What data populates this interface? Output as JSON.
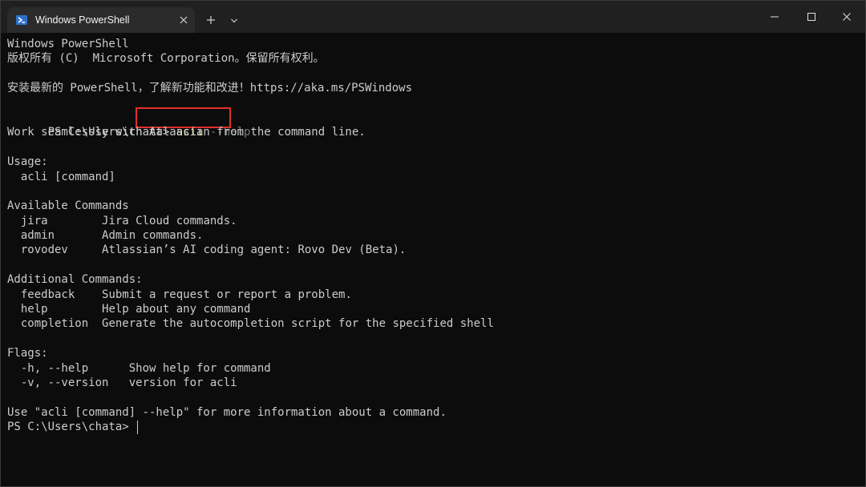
{
  "window": {
    "tab_title": "Windows PowerShell",
    "top_strip_text": "PS C:\\Users\\chata> acli"
  },
  "icons": {
    "tab": "powershell-icon",
    "close_tab": "close-icon",
    "new_tab": "plus-icon",
    "dropdown": "chevron-down-icon",
    "minimize": "minimize-icon",
    "maximize": "maximize-icon",
    "close_window": "close-icon"
  },
  "colors": {
    "background": "#0c0c0c",
    "titlebar": "#202020",
    "text": "#cccccc",
    "command": "#f9f1a5",
    "argument": "#767676",
    "highlight": "#e0302b"
  },
  "terminal": {
    "header1": "Windows PowerShell",
    "header2": "版权所有 (C)  Microsoft Corporation。保留所有权利。",
    "install_hint": "安装最新的 PowerShell，了解新功能和改进！https://aka.ms/PSWindows",
    "prompt": "PS C:\\Users\\chata> ",
    "command": "acli",
    "argument": " --help",
    "description": "Work seamlessly with Atlassian from the command line.",
    "usage_header": "Usage:",
    "usage_line": "  acli [command]",
    "available_header": "Available Commands",
    "available": [
      {
        "name": "  jira        ",
        "desc": "Jira Cloud commands."
      },
      {
        "name": "  admin       ",
        "desc": "Admin commands."
      },
      {
        "name": "  rovodev     ",
        "desc": "Atlassian’s AI coding agent: Rovo Dev (Beta)."
      }
    ],
    "additional_header": "Additional Commands:",
    "additional": [
      {
        "name": "  feedback    ",
        "desc": "Submit a request or report a problem."
      },
      {
        "name": "  help        ",
        "desc": "Help about any command"
      },
      {
        "name": "  completion  ",
        "desc": "Generate the autocompletion script for the specified shell"
      }
    ],
    "flags_header": "Flags:",
    "flags": [
      {
        "name": "  -h, --help      ",
        "desc": "Show help for command"
      },
      {
        "name": "  -v, --version   ",
        "desc": "version for acli"
      }
    ],
    "footer": "Use \"acli [command] --help\" for more information about a command.",
    "final_prompt": "PS C:\\Users\\chata> "
  }
}
